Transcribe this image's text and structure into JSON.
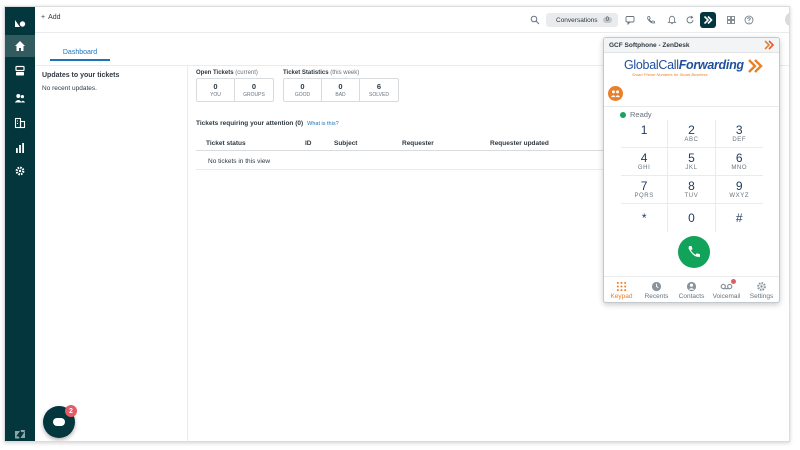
{
  "header": {
    "add_label": "Add",
    "conversations_label": "Conversations",
    "conversations_count": "0"
  },
  "tabs": [
    {
      "label": "Dashboard"
    }
  ],
  "left_panel": {
    "title": "Updates to your tickets",
    "empty_text": "No recent updates."
  },
  "open_tickets": {
    "label": "Open Tickets",
    "qualifier": "(current)",
    "boxes": [
      {
        "value": "0",
        "caption": "YOU"
      },
      {
        "value": "0",
        "caption": "GROUPS"
      }
    ]
  },
  "ticket_stats": {
    "label": "Ticket Statistics",
    "qualifier": "(this week)",
    "boxes": [
      {
        "value": "0",
        "caption": "GOOD"
      },
      {
        "value": "0",
        "caption": "BAD"
      },
      {
        "value": "6",
        "caption": "SOLVED"
      }
    ]
  },
  "attention": {
    "title": "Tickets requiring your attention (0)",
    "link": "What is this?",
    "columns": [
      "Ticket status",
      "ID",
      "Subject",
      "Requester",
      "Requester updated"
    ],
    "empty_text": "No tickets in this view"
  },
  "chat_badge": "2",
  "softphone": {
    "title": "GCF Softphone - ZenDesk",
    "brand_part1": "Global",
    "brand_part2": "Call",
    "brand_part3": "Forwarding",
    "brand_tagline": "Smart Phone Numbers for Smart Business",
    "status": "Ready",
    "keys": [
      [
        {
          "d": "1",
          "l": ""
        },
        {
          "d": "2",
          "l": "ABC"
        },
        {
          "d": "3",
          "l": "DEF"
        }
      ],
      [
        {
          "d": "4",
          "l": "GHI"
        },
        {
          "d": "5",
          "l": "JKL"
        },
        {
          "d": "6",
          "l": "MNO"
        }
      ],
      [
        {
          "d": "7",
          "l": "PQRS"
        },
        {
          "d": "8",
          "l": "TUV"
        },
        {
          "d": "9",
          "l": "WXYZ"
        }
      ],
      [
        {
          "d": "*",
          "l": ""
        },
        {
          "d": "0",
          "l": ""
        },
        {
          "d": "#",
          "l": ""
        }
      ]
    ],
    "tabs": [
      {
        "label": "Keypad"
      },
      {
        "label": "Recents"
      },
      {
        "label": "Contacts"
      },
      {
        "label": "Voicemail"
      },
      {
        "label": "Settings"
      }
    ]
  },
  "colors": {
    "nav_bg": "#03363d",
    "accent_blue": "#1f73b7",
    "accent_orange": "#e9802a",
    "call_green": "#11a35a",
    "ready_green": "#1aa260"
  }
}
